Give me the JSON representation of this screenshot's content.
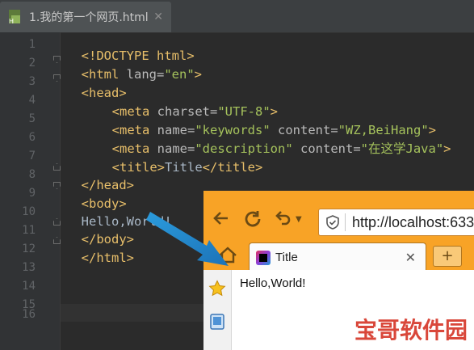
{
  "editor": {
    "tab_title": "1.我的第一个网页.html",
    "tab_close": "✕",
    "line_numbers": [
      "1",
      "2",
      "3",
      "4",
      "5",
      "6",
      "7",
      "8",
      "9",
      "10",
      "11",
      "12",
      "13",
      "14",
      "15",
      "16"
    ],
    "code": {
      "l1": "<!DOCTYPE html>",
      "l2_open": "<html ",
      "l2_attr": "lang=",
      "l2_val": "\"en\"",
      "l2_close": ">",
      "l3": "<head>",
      "l4_tag": "<meta ",
      "l4_attr": "charset=",
      "l4_val": "\"UTF-8\"",
      "l4_close": ">",
      "l5_tag": "<meta ",
      "l5_attr1": "name=",
      "l5_val1": "\"keywords\"",
      "l5_attr2": " content=",
      "l5_val2": "\"WZ,BeiHang\"",
      "l5_close": ">",
      "l6_tag": "<meta ",
      "l6_attr1": "name=",
      "l6_val1": "\"description\"",
      "l6_attr2": " content=",
      "l6_val2": "\"在这学Java\"",
      "l6_close": ">",
      "l7_open": "<title>",
      "l7_text": "Title",
      "l7_close": "</title>",
      "l8": "</head>",
      "l9": "<body>",
      "l10": "Hello,World!",
      "l11": "</body>",
      "l12": "</html>"
    }
  },
  "browser": {
    "url": "http://localhost:633",
    "tab_title": "Title",
    "tab_close": "✕",
    "new_tab": "+",
    "page_text": "Hello,World!",
    "accent_color": "#f8a326"
  },
  "watermark": "宝哥软件园"
}
